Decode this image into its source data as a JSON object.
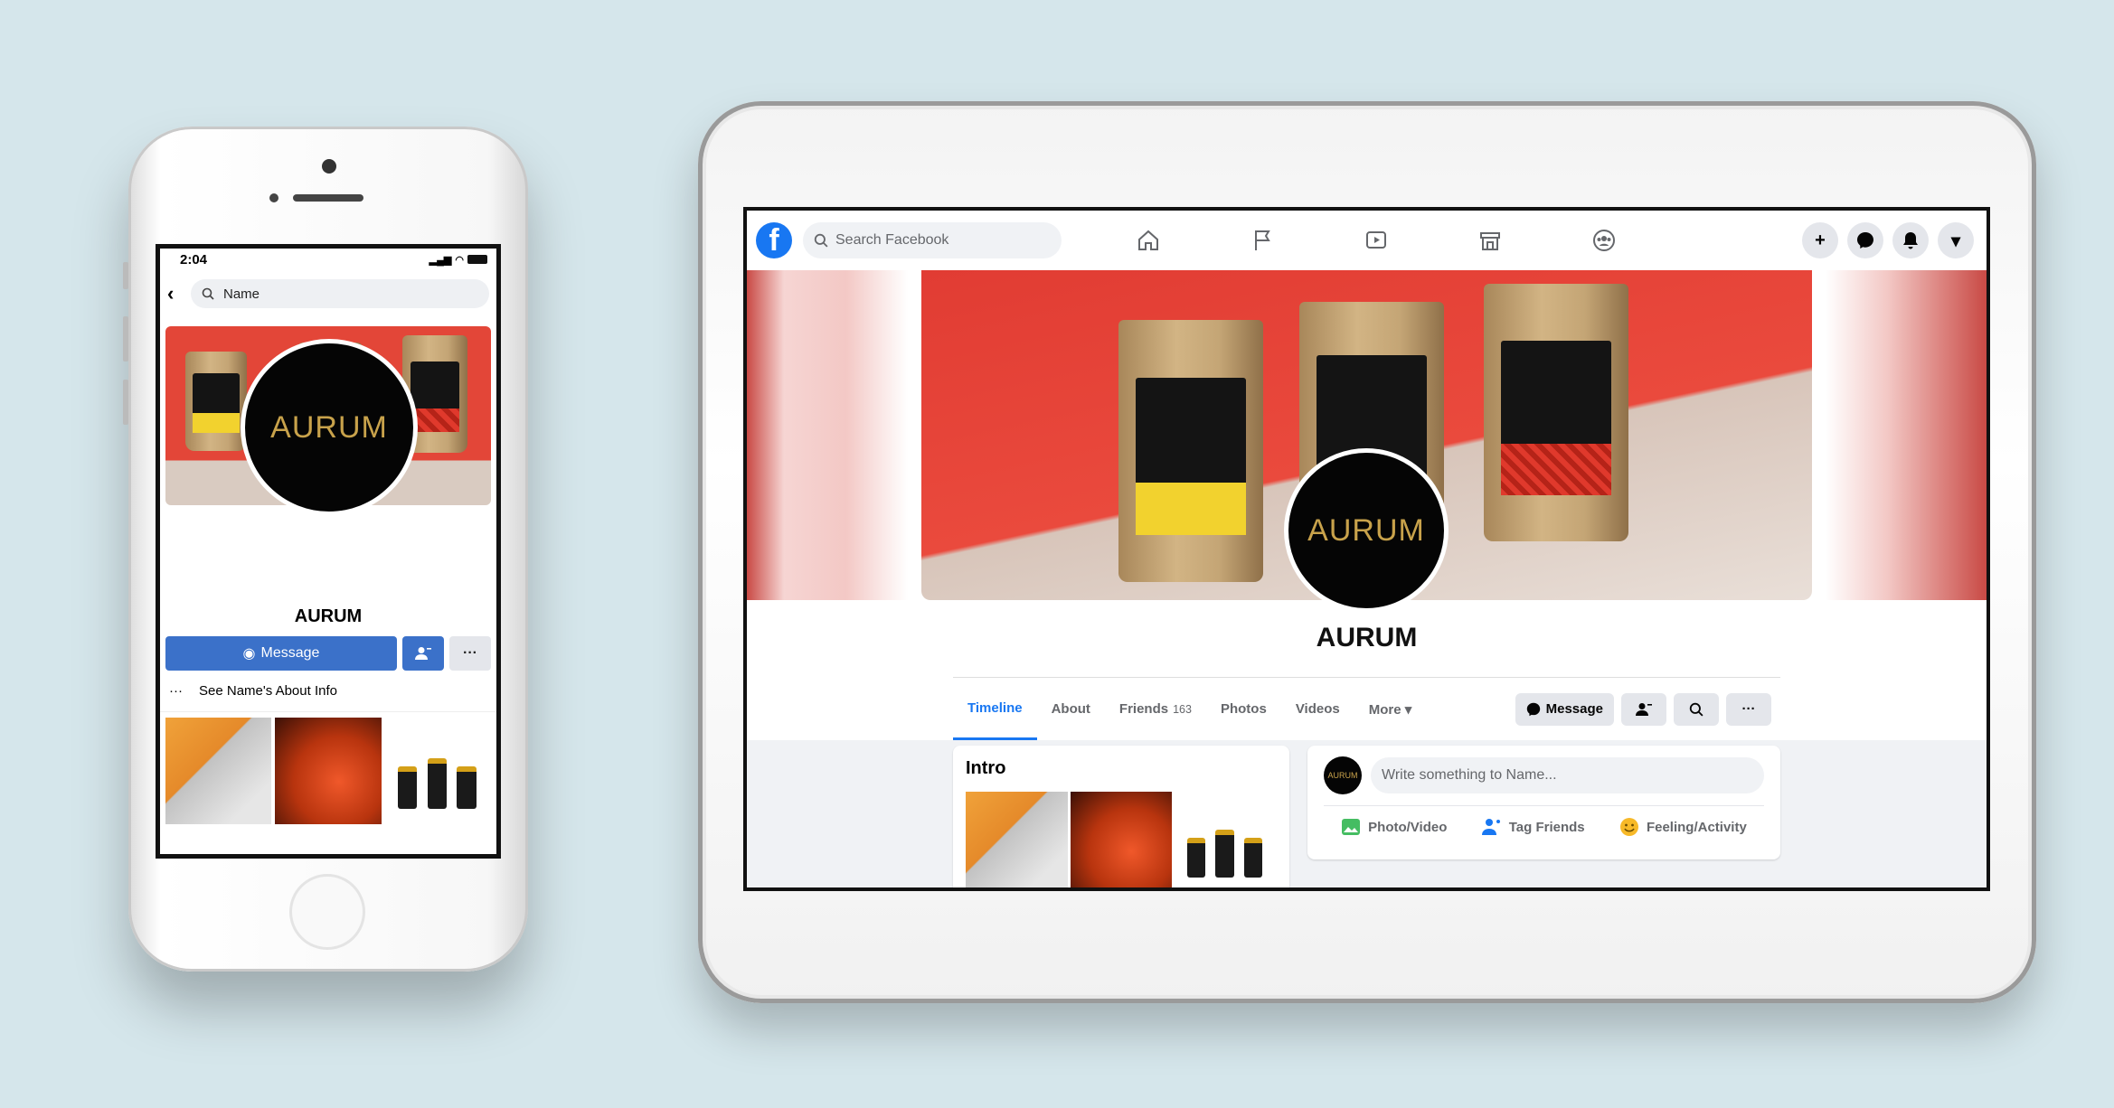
{
  "brand": {
    "name": "AURUM",
    "logo_text": "AURUM",
    "gold": "#c8a24b"
  },
  "phone": {
    "time": "2:04",
    "search_placeholder": "Name",
    "page_name": "AURUM",
    "message_label": "Message",
    "more_label": "···",
    "about_dots": "···",
    "about_label": "See Name's About Info"
  },
  "tablet": {
    "fb_logo": "f",
    "search_placeholder": "Search Facebook",
    "page_name": "AURUM",
    "tabs": [
      {
        "label": "Timeline",
        "active": true
      },
      {
        "label": "About"
      },
      {
        "label": "Friends",
        "count": "163"
      },
      {
        "label": "Photos"
      },
      {
        "label": "Videos"
      },
      {
        "label": "More ▾"
      }
    ],
    "message_label": "Message",
    "more_label": "···",
    "intro_title": "Intro",
    "write_placeholder": "Write something to Name...",
    "post_actions": [
      {
        "label": "Photo/Video",
        "color": "#45bd62"
      },
      {
        "label": "Tag Friends",
        "color": "#1877f2"
      },
      {
        "label": "Feeling/Activity",
        "color": "#f7b928"
      }
    ]
  },
  "colors": {
    "facebook_blue": "#1877f2",
    "message_blue": "#3b71c9",
    "background": "#d5e6eb",
    "cover_red": "#e13c33"
  }
}
